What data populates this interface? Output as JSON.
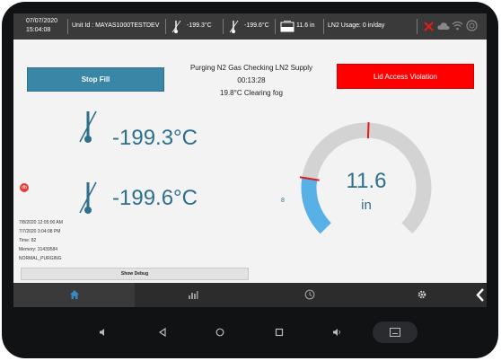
{
  "status_bar": {
    "date": "07/07/2020",
    "time": "15:04:08",
    "unit_id": "Unit Id : MAYAS1000TESTDEV",
    "temp1": "-199.3°C",
    "temp2": "-199.6°C",
    "level": "11.6 in",
    "ln2_usage": "LN2 Usage: 0 in/day"
  },
  "main": {
    "stop_fill_label": "Stop Fill",
    "lid_alarm_label": "Lid Access Violation",
    "status_message": "Purging N2 Gas  Checking LN2 Supply",
    "timer": "00:13:28",
    "fog_message": "19.8°C Clearing fog",
    "temp1": "-199.3°C",
    "temp2": "-199.6°C",
    "badge": "db",
    "info_lines": [
      "7/8/2020 12:05:00 AM",
      "7/7/2020 3:04:08 PM",
      "Time:  82",
      "Memory: 31439584",
      "NORMAL_PURGING"
    ],
    "debug_button_label": "Show Debug"
  },
  "gauge": {
    "value": "11.6",
    "unit": "in",
    "tick_label": "8",
    "fill_fraction": 0.2,
    "colors": {
      "track": "#d3d3d3",
      "fill": "#58b1e6",
      "marker": "#e41b1b",
      "text": "#2e6f8e"
    }
  },
  "nav": {
    "tabs": [
      "home-icon",
      "chart-icon",
      "history-icon",
      "settings-icon"
    ],
    "active": "home-icon"
  },
  "colors": {
    "status_bar": "#3a3a3a",
    "stop_button": "#3a86a7",
    "alarm": "#ff0000",
    "value_text": "#2e6f8e"
  }
}
